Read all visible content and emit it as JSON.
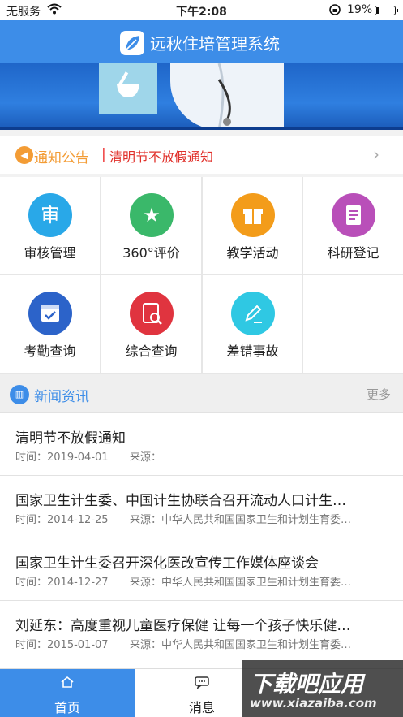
{
  "status_bar": {
    "carrier": "无服务",
    "time": "下午2:08",
    "battery": "19%",
    "battery_level": 0.19
  },
  "header": {
    "title": "远秋住培管理系统"
  },
  "notice": {
    "label": "通知公告",
    "separator": "|",
    "text": "清明节不放假通知"
  },
  "grid": {
    "items": [
      {
        "label": "审核管理",
        "icon": "shield-icon",
        "color": "#29a8e8",
        "glyph": "审"
      },
      {
        "label": "360°评价",
        "icon": "star-icon",
        "color": "#3ab86a",
        "glyph": "★"
      },
      {
        "label": "教学活动",
        "icon": "gift-icon",
        "color": "#f39c1a",
        "glyph": "🎁"
      },
      {
        "label": "科研登记",
        "icon": "document-icon",
        "color": "#b94fb9",
        "glyph": "≡"
      },
      {
        "label": "考勤查询",
        "icon": "calendar-check-icon",
        "color": "#2c63c9",
        "glyph": "✓"
      },
      {
        "label": "综合查询",
        "icon": "search-document-icon",
        "color": "#e0343f",
        "glyph": "⌕"
      },
      {
        "label": "差错事故",
        "icon": "pencil-icon",
        "color": "#2fc8e3",
        "glyph": "✎"
      }
    ]
  },
  "news": {
    "title": "新闻资讯",
    "more": "更多",
    "items": [
      {
        "title": "清明节不放假通知",
        "time": "时间：2019-04-01",
        "source": "来源："
      },
      {
        "title": "国家卫生计生委、中国计生协联合召开流动人口计生协工作会议",
        "time": "时间：2014-12-25",
        "source": "来源：中华人民共和国国家卫生和计划生育委员会"
      },
      {
        "title": "国家卫生计生委召开深化医改宣传工作媒体座谈会",
        "time": "时间：2014-12-27",
        "source": "来源：中华人民共和国国家卫生和计划生育委员会"
      },
      {
        "title": "刘延东：高度重视儿童医疗保健 让每一个孩子快乐健康成长",
        "time": "时间：2015-01-07",
        "source": "来源：中华人民共和国国家卫生和计划生育委员会"
      }
    ]
  },
  "tabbar": {
    "tabs": [
      {
        "label": "首页",
        "icon": "home-icon",
        "active": true
      },
      {
        "label": "消息",
        "icon": "message-icon",
        "active": false
      }
    ]
  },
  "watermark": {
    "line1": "下载吧应用",
    "line2": "www.xiazaiba.com"
  }
}
